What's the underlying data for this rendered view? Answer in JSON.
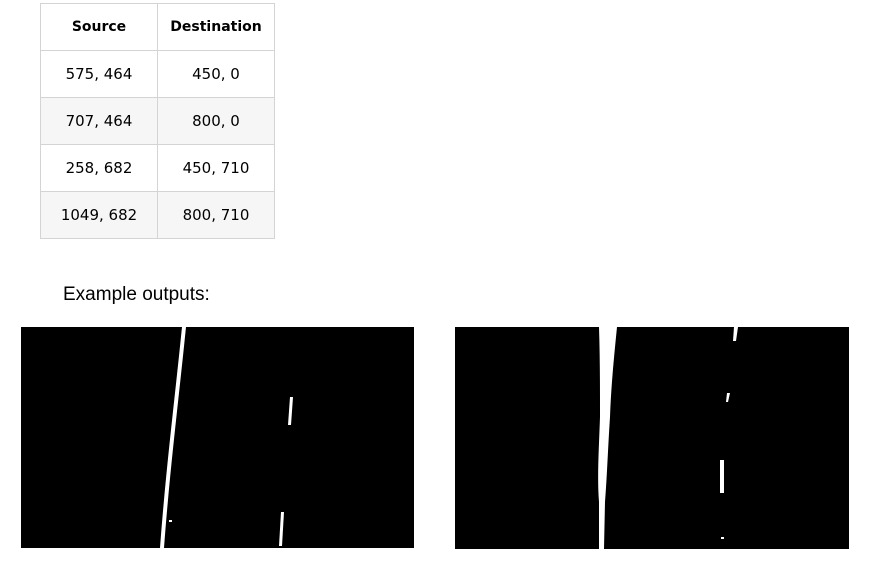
{
  "table": {
    "headers": [
      "Source",
      "Destination"
    ],
    "rows": [
      {
        "source": "575, 464",
        "destination": "450, 0"
      },
      {
        "source": "707, 464",
        "destination": "800, 0"
      },
      {
        "source": "258, 682",
        "destination": "450, 710"
      },
      {
        "source": "1049, 682",
        "destination": "800, 710"
      }
    ]
  },
  "caption": "Example outputs:",
  "colors": {
    "image_background": "#000000",
    "lane_pixels": "#ffffff",
    "table_border": "#d4d4d4",
    "alt_row": "#f6f6f6"
  }
}
